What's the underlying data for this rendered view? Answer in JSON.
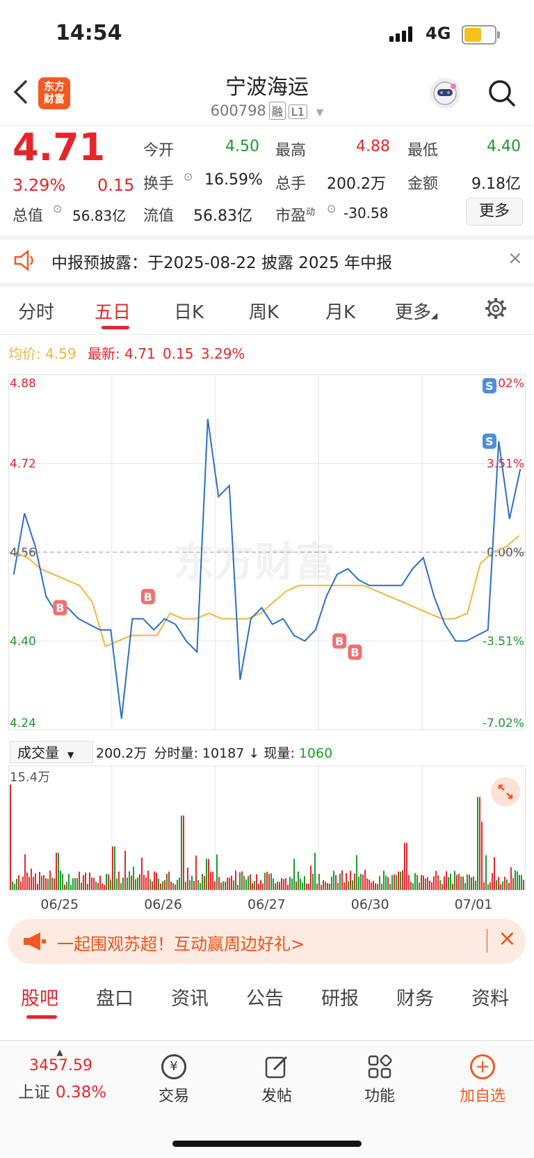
{
  "status": {
    "time": "14:54",
    "network": "4G"
  },
  "header": {
    "logo_text": "东方\n财富",
    "stock_name": "宁波海运",
    "stock_code": "600798",
    "tag_margin": "融",
    "tag_level": "L1"
  },
  "quote": {
    "price": "4.71",
    "change_pct": "3.29%",
    "change": "0.15",
    "open_label": "今开",
    "open": "4.50",
    "high_label": "最高",
    "high": "4.88",
    "low_label": "最低",
    "low": "4.40",
    "turnover_label": "换手",
    "turnover": "16.59%",
    "volume_label": "总手",
    "volume": "200.2万",
    "amount_label": "金额",
    "amount": "9.18亿",
    "mktcap_label": "总值",
    "mktcap": "56.83亿",
    "float_label": "流值",
    "float_cap": "56.83亿",
    "pe_label": "市盈",
    "pe_sup": "动",
    "pe": "-30.58",
    "more_button": "更多"
  },
  "notice": {
    "text": "中报预披露：于2025-08-22 披露 2025 年中报"
  },
  "chart_tabs": [
    "分时",
    "五日",
    "日K",
    "周K",
    "月K",
    "更多"
  ],
  "active_chart_tab": "五日",
  "legend": {
    "avg_label": "均价:",
    "avg": "4.59",
    "latest_label": "最新:",
    "latest": "4.71",
    "latest_change": "0.15",
    "latest_pct": "3.29%"
  },
  "volume_bar": {
    "selector": "成交量",
    "total": "200.2万",
    "tick_label": "分时量:",
    "tick": "10187",
    "arrow": "↓",
    "now_label": "现量:",
    "now": "1060",
    "max_label": "15.4万"
  },
  "watermark": "东方财富",
  "chart_data": {
    "type": "line",
    "title": "",
    "y_left_ticks": [
      "4.88",
      "4.72",
      "4.56",
      "4.40",
      "4.24"
    ],
    "y_right_ticks": [
      "7.02%",
      "3.51%",
      "0.00%",
      "-3.51%",
      "-7.02%"
    ],
    "ylim": [
      4.24,
      4.88
    ],
    "prev_close": 4.56,
    "x_categories": [
      "06/25",
      "06/26",
      "06/27",
      "06/30",
      "07/01"
    ],
    "series": [
      {
        "values": [
          4.52,
          4.63,
          4.57,
          4.48,
          4.45,
          4.46,
          4.44,
          4.43,
          4.42,
          4.42,
          4.26,
          4.44,
          4.44,
          4.42,
          4.44,
          4.43,
          4.4,
          4.38,
          4.8,
          4.66,
          4.68,
          4.33,
          4.44,
          4.46,
          4.43,
          4.44,
          4.41,
          4.4,
          4.42,
          4.48,
          4.52,
          4.53,
          4.51,
          4.5,
          4.5,
          4.5,
          4.5,
          4.53,
          4.55,
          4.48,
          4.43,
          4.4,
          4.4,
          4.41,
          4.42,
          4.76,
          4.62,
          4.71
        ]
      },
      {
        "values": [
          4.56,
          4.55,
          4.53,
          4.52,
          4.51,
          4.5,
          4.47,
          4.39,
          4.4,
          4.41,
          4.41,
          4.41,
          4.45,
          4.44,
          4.44,
          4.45,
          4.44,
          4.44,
          4.44,
          4.45,
          4.47,
          4.49,
          4.5,
          4.5,
          4.5,
          4.5,
          4.5,
          4.5,
          4.49,
          4.48,
          4.47,
          4.46,
          4.45,
          4.44,
          4.44,
          4.45,
          4.54,
          4.56,
          4.57,
          4.59
        ]
      }
    ],
    "markers": [
      {
        "label": "B",
        "day": "06/25"
      },
      {
        "label": "B",
        "day": "06/26"
      },
      {
        "label": "B",
        "day": "06/30"
      },
      {
        "label": "B",
        "day": "06/30"
      },
      {
        "label": "S",
        "day": "07/01"
      },
      {
        "label": "S",
        "day": "07/01"
      }
    ],
    "volume_ylim": [
      0,
      154000
    ]
  },
  "promo": {
    "text": "一起围观苏超！互动赢周边好礼>"
  },
  "bottom_tabs": [
    "股吧",
    "盘口",
    "资讯",
    "公告",
    "研报",
    "财务",
    "资料"
  ],
  "index": {
    "value": "3457.59",
    "name": "上证",
    "pct": "0.38%"
  },
  "nav": {
    "trade": "交易",
    "post": "发帖",
    "func": "功能",
    "add": "加自选"
  },
  "colors": {
    "up": "#e4262b",
    "down": "#1a9a2a",
    "line": "#2a6fc9",
    "avg": "#f3b53a",
    "accent": "#f15a22"
  }
}
